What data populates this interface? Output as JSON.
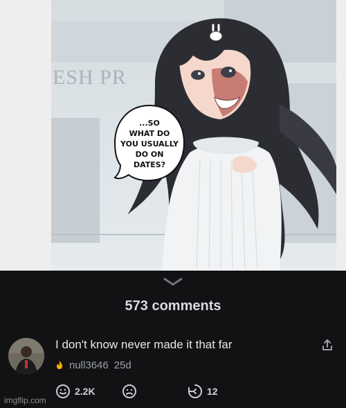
{
  "image": {
    "store_sign": "ESH PR",
    "speech_bubble": [
      "...SO",
      "WHAT DO",
      "YOU USUALLY",
      "DO ON",
      "DATES?"
    ]
  },
  "comments": {
    "count_label": "573 comments"
  },
  "comment": {
    "text": "I don't know never made it that far",
    "username": "null3646",
    "age": "25d",
    "upvotes": "2.2K",
    "replies": "12"
  },
  "watermark": "imgflip.com"
}
